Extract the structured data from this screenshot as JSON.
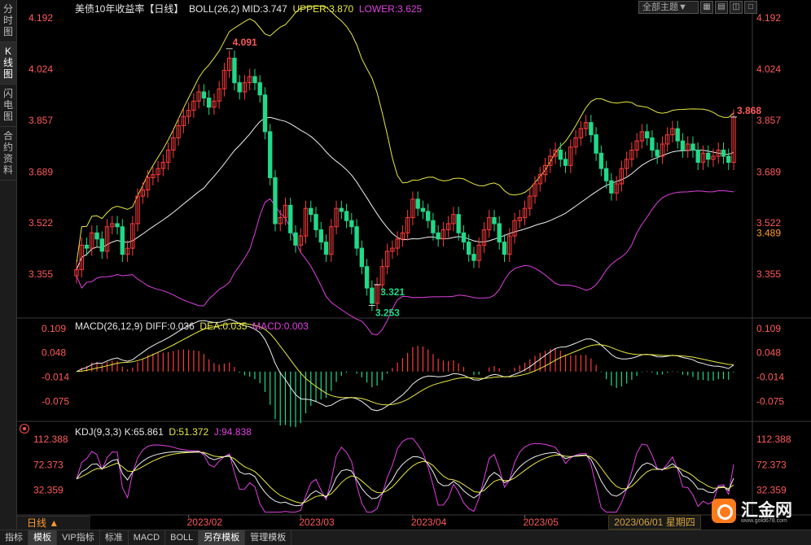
{
  "sidebar": {
    "items": [
      {
        "label": "分时图",
        "active": false
      },
      {
        "label": "K线图",
        "active": true
      },
      {
        "label": "闪电图",
        "active": false
      },
      {
        "label": "合约资料",
        "active": false
      }
    ]
  },
  "header": {
    "title": "美债10年收益率【日线】",
    "boll": {
      "label": "BOLL(26,2)",
      "mid": "MID:3.747",
      "upper": "UPPER:3.870",
      "lower": "LOWER:3.625"
    },
    "theme_select": "全部主题▼",
    "window_icons": [
      "grid-icon",
      "layout-icon",
      "split-icon",
      "maximize-icon"
    ]
  },
  "macd": {
    "label": "MACD(26,12,9)",
    "diff": "DIFF:0.036",
    "dea": "DEA:0.035",
    "macd": "MACD:0.003"
  },
  "kdj": {
    "label": "KDJ(9,3,3)",
    "k": "K:65.861",
    "d": "D:51.372",
    "j": "J:94.838"
  },
  "daily_label": "日线 ▲",
  "date_tooltip": "2023/06/01 星期四",
  "bottom_tabs": [
    {
      "label": "指标",
      "active": false
    },
    {
      "label": "模板",
      "active": true
    },
    {
      "label": "VIP指标",
      "active": false
    },
    {
      "label": "标准",
      "active": false
    },
    {
      "label": "MACD",
      "active": false
    },
    {
      "label": "BOLL",
      "active": false
    },
    {
      "label": "另存模板",
      "active": true
    },
    {
      "label": "管理模板",
      "active": false
    }
  ],
  "logo": {
    "name": "汇金网",
    "url": "www.gold678.com"
  },
  "colors": {
    "up": "#ff3b3b",
    "down": "#21d989",
    "mid": "#f0f0f0",
    "upper": "#e8e845",
    "lower": "#e040e0",
    "price_text": "#ff5a5a",
    "current_price": "#ff9a2e"
  },
  "chart_data": [
    {
      "type": "candlestick",
      "title": "美债10年收益率【日线】",
      "y_ticks": [
        "4.192",
        "4.024",
        "3.857",
        "3.689",
        "3.522",
        "3.355"
      ],
      "ylim": [
        3.22,
        4.21
      ],
      "x_ticks": [
        "2023/02",
        "2023/03",
        "2023/04",
        "2023/05"
      ],
      "current_value": "3.489",
      "annotations": [
        {
          "text": "4.091",
          "value": 4.091
        },
        {
          "text": "3.321",
          "value": 3.321
        },
        {
          "text": "3.253",
          "value": 3.253
        },
        {
          "text": "3.868",
          "value": 3.868
        }
      ],
      "closes": [
        3.37,
        3.45,
        3.44,
        3.49,
        3.47,
        3.43,
        3.51,
        3.52,
        3.51,
        3.42,
        3.44,
        3.52,
        3.61,
        3.63,
        3.67,
        3.68,
        3.7,
        3.72,
        3.76,
        3.8,
        3.84,
        3.87,
        3.89,
        3.92,
        3.95,
        3.93,
        3.9,
        3.92,
        3.96,
        4.02,
        4.06,
        3.98,
        3.95,
        3.98,
        4.0,
        3.98,
        3.94,
        3.82,
        3.67,
        3.52,
        3.54,
        3.58,
        3.49,
        3.45,
        3.48,
        3.57,
        3.55,
        3.5,
        3.46,
        3.42,
        3.51,
        3.57,
        3.56,
        3.53,
        3.51,
        3.44,
        3.38,
        3.31,
        3.26,
        3.32,
        3.38,
        3.43,
        3.44,
        3.47,
        3.49,
        3.54,
        3.6,
        3.57,
        3.56,
        3.53,
        3.49,
        3.47,
        3.5,
        3.52,
        3.55,
        3.49,
        3.46,
        3.42,
        3.4,
        3.45,
        3.5,
        3.54,
        3.52,
        3.46,
        3.42,
        3.48,
        3.53,
        3.54,
        3.57,
        3.61,
        3.65,
        3.68,
        3.71,
        3.74,
        3.76,
        3.73,
        3.71,
        3.77,
        3.8,
        3.83,
        3.85,
        3.81,
        3.75,
        3.7,
        3.66,
        3.62,
        3.65,
        3.7,
        3.73,
        3.76,
        3.79,
        3.82,
        3.8,
        3.76,
        3.74,
        3.78,
        3.81,
        3.83,
        3.79,
        3.76,
        3.78,
        3.76,
        3.72,
        3.75,
        3.73,
        3.74,
        3.76,
        3.74,
        3.72,
        3.868
      ],
      "boll": {
        "period": 26,
        "k": 2,
        "mid": 3.747,
        "upper": 3.87,
        "lower": 3.625
      }
    },
    {
      "type": "bar+line",
      "name": "MACD(26,12,9)",
      "y_ticks": [
        "0.109",
        "0.048",
        "-0.014",
        "-0.075"
      ],
      "ylim": [
        -0.13,
        0.125
      ],
      "diff": 0.036,
      "dea": 0.035,
      "macd": 0.003
    },
    {
      "type": "line",
      "name": "KDJ(9,3,3)",
      "y_ticks": [
        "112.388",
        "72.373",
        "32.359"
      ],
      "ylim": [
        -5,
        125
      ],
      "k": 65.861,
      "d": 51.372,
      "j": 94.838
    }
  ]
}
